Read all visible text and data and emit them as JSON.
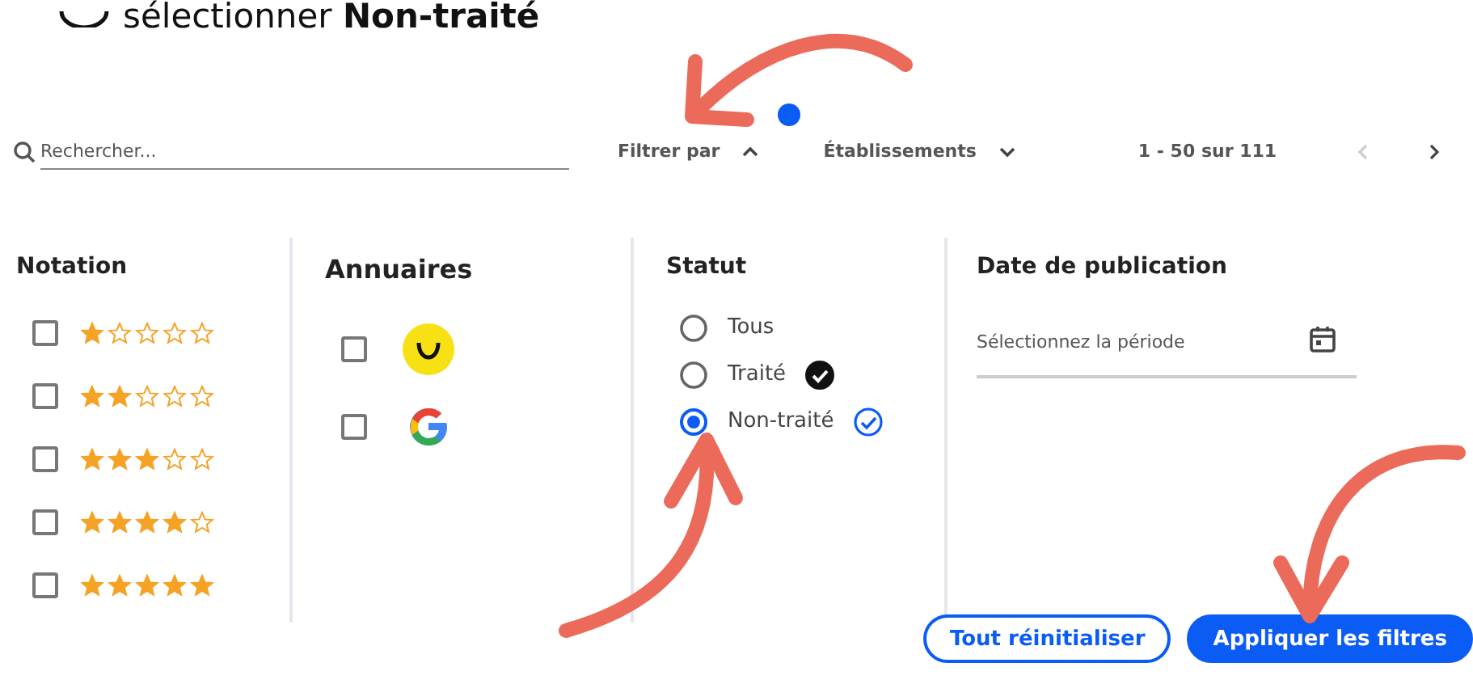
{
  "instruction": {
    "text": "sélectionner **Non-traité**"
  },
  "toolbar": {
    "search": {
      "placeholder": "Rechercher..."
    },
    "filter": {
      "label": "Filtrer par",
      "expanded": true,
      "active": true
    },
    "sort": {
      "label": "Établissements",
      "expanded": false
    },
    "pagination": {
      "range": "1 - 50 sur 111",
      "prev_disabled": true,
      "next_disabled": false
    }
  },
  "notation": {
    "title": "Notation",
    "options": [
      {
        "stars": 1,
        "checked": false
      },
      {
        "stars": 2,
        "checked": false
      },
      {
        "stars": 3,
        "checked": false
      },
      {
        "stars": 4,
        "checked": false
      },
      {
        "stars": 5,
        "checked": false
      }
    ]
  },
  "annuaires": {
    "title": "Annuaires",
    "options": [
      {
        "kind": "smiley",
        "checked": false
      },
      {
        "kind": "google",
        "checked": false
      }
    ]
  },
  "statut": {
    "title": "Statut",
    "options": [
      {
        "label": "Tous",
        "selected": false
      },
      {
        "label": "Traité",
        "selected": false,
        "kind": "filled_check"
      },
      {
        "label": "Non-traité",
        "selected": true,
        "kind": "outline_check"
      }
    ]
  },
  "date": {
    "title": "Date de publication",
    "placeholder": "Sélectionnez la période"
  },
  "buttons": [
    {
      "label": "Tout réinitialiser",
      "kind": "outline"
    },
    {
      "label": "Appliquer les filtres",
      "kind": "primary"
    }
  ]
}
